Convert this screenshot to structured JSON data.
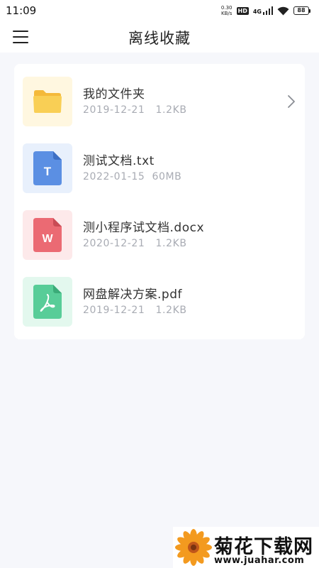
{
  "status_bar": {
    "time": "11:09",
    "net_speed_value": "0.30",
    "net_speed_unit": "KB/s",
    "hd_badge": "HD",
    "network_type": "4G",
    "battery_level": "88",
    "icons": [
      "hd-icon",
      "signal-icon",
      "wifi-icon",
      "battery-icon"
    ]
  },
  "header": {
    "title": "离线收藏",
    "menu_icon": "menu-icon"
  },
  "files": [
    {
      "name": "我的文件夹",
      "date": "2019-12-21",
      "size": "1.2KB",
      "icon": "folder-icon",
      "thumb_bg": "#fff7e0",
      "color": "#f9cf55",
      "has_chevron": true
    },
    {
      "name": "测试文档.txt",
      "date": "2022-01-15",
      "size": "60MB",
      "icon": "txt-file-icon",
      "letter": "T",
      "thumb_bg": "#e8f0fc",
      "color": "#5b8fe3",
      "has_chevron": false
    },
    {
      "name": "测小程序试文档.docx",
      "date": "2020-12-21",
      "size": "1.2KB",
      "icon": "word-file-icon",
      "letter": "W",
      "thumb_bg": "#fde9ea",
      "color": "#eb6a73",
      "has_chevron": false
    },
    {
      "name": "网盘解决方案.pdf",
      "date": "2019-12-21",
      "size": "1.2KB",
      "icon": "pdf-file-icon",
      "thumb_bg": "#e3f8ee",
      "color": "#58cd98",
      "has_chevron": false
    }
  ],
  "watermark": {
    "title": "菊花下载网",
    "url": "www.juahar.com",
    "logo_icon": "flower-logo-icon"
  }
}
